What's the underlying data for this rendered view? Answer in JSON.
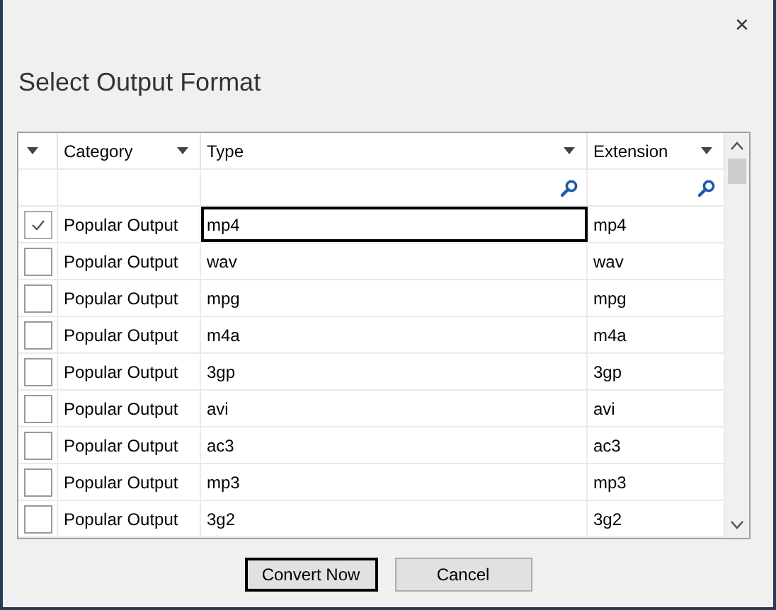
{
  "window": {
    "close": "×"
  },
  "heading": "Select Output Format",
  "table": {
    "columns": [
      "Category",
      "Type",
      "Extension"
    ],
    "rows": [
      {
        "checked": true,
        "focused": true,
        "category": "Popular Output",
        "type": "mp4",
        "extension": "mp4"
      },
      {
        "checked": false,
        "focused": false,
        "category": "Popular Output",
        "type": "wav",
        "extension": "wav"
      },
      {
        "checked": false,
        "focused": false,
        "category": "Popular Output",
        "type": "mpg",
        "extension": "mpg"
      },
      {
        "checked": false,
        "focused": false,
        "category": "Popular Output",
        "type": "m4a",
        "extension": "m4a"
      },
      {
        "checked": false,
        "focused": false,
        "category": "Popular Output",
        "type": "3gp",
        "extension": "3gp"
      },
      {
        "checked": false,
        "focused": false,
        "category": "Popular Output",
        "type": "avi",
        "extension": "avi"
      },
      {
        "checked": false,
        "focused": false,
        "category": "Popular Output",
        "type": "ac3",
        "extension": "ac3"
      },
      {
        "checked": false,
        "focused": false,
        "category": "Popular Output",
        "type": "mp3",
        "extension": "mp3"
      },
      {
        "checked": false,
        "focused": false,
        "category": "Popular Output",
        "type": "3g2",
        "extension": "3g2"
      }
    ]
  },
  "buttons": [
    {
      "label": "Convert Now",
      "default": true
    },
    {
      "label": "Cancel",
      "default": false
    }
  ]
}
